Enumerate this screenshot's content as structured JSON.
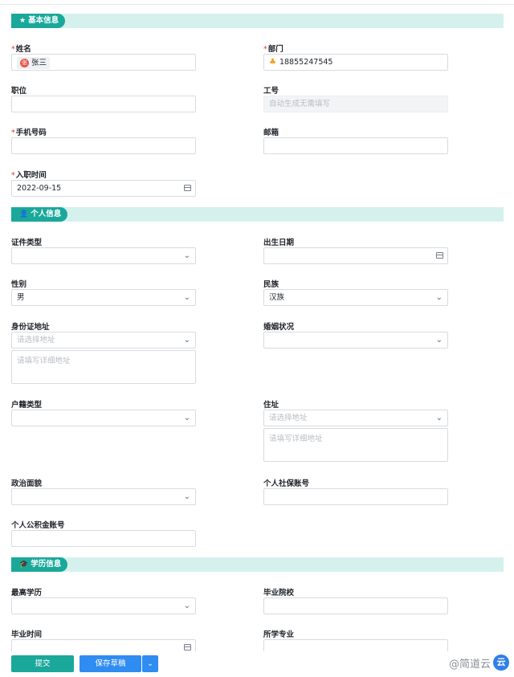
{
  "sections": {
    "basic": {
      "icon": "★",
      "title": "基本信息"
    },
    "personal": {
      "icon": "👤",
      "title": "个人信息"
    },
    "education": {
      "icon": "🎓",
      "title": "学历信息"
    }
  },
  "fields": {
    "name": {
      "label": "姓名",
      "required": "*",
      "chip_avatar": "张",
      "chip_text": "张三"
    },
    "department": {
      "label": "部门",
      "required": "*",
      "value": "18855247545"
    },
    "position": {
      "label": "职位",
      "value": ""
    },
    "employee_id": {
      "label": "工号",
      "placeholder": "自动生成无需填写"
    },
    "phone": {
      "label": "手机号码",
      "required": "*",
      "value": ""
    },
    "email": {
      "label": "邮箱",
      "value": ""
    },
    "hire_date": {
      "label": "入职时间",
      "required": "*",
      "value": "2022-09-15"
    },
    "id_type": {
      "label": "证件类型",
      "value": ""
    },
    "birth_date": {
      "label": "出生日期",
      "value": ""
    },
    "gender": {
      "label": "性别",
      "value": "男"
    },
    "ethnicity": {
      "label": "民族",
      "value": "汉族"
    },
    "id_address": {
      "label": "身份证地址",
      "placeholder": "请选择地址",
      "detail_placeholder": "请填写详细地址"
    },
    "marital": {
      "label": "婚姻状况",
      "value": ""
    },
    "household_type": {
      "label": "户籍类型",
      "value": ""
    },
    "residence": {
      "label": "住址",
      "placeholder": "请选择地址",
      "detail_placeholder": "请填写详细地址"
    },
    "political": {
      "label": "政治面貌",
      "value": ""
    },
    "social_security": {
      "label": "个人社保账号",
      "value": ""
    },
    "housing_fund": {
      "label": "个人公积金账号",
      "value": ""
    },
    "education_level": {
      "label": "最高学历",
      "value": ""
    },
    "school": {
      "label": "毕业院校",
      "value": ""
    },
    "grad_time": {
      "label": "毕业时间",
      "value": ""
    },
    "major": {
      "label": "所学专业",
      "value": ""
    }
  },
  "footer": {
    "submit": "提交",
    "save_draft": "保存草稿",
    "more_icon": "chevron-down-icon",
    "watermark": "@简道云"
  },
  "colors": {
    "accent": "#1aa89a",
    "section_bg": "#d5f1ee",
    "primary": "#2f8cf0",
    "required": "#e53935"
  }
}
